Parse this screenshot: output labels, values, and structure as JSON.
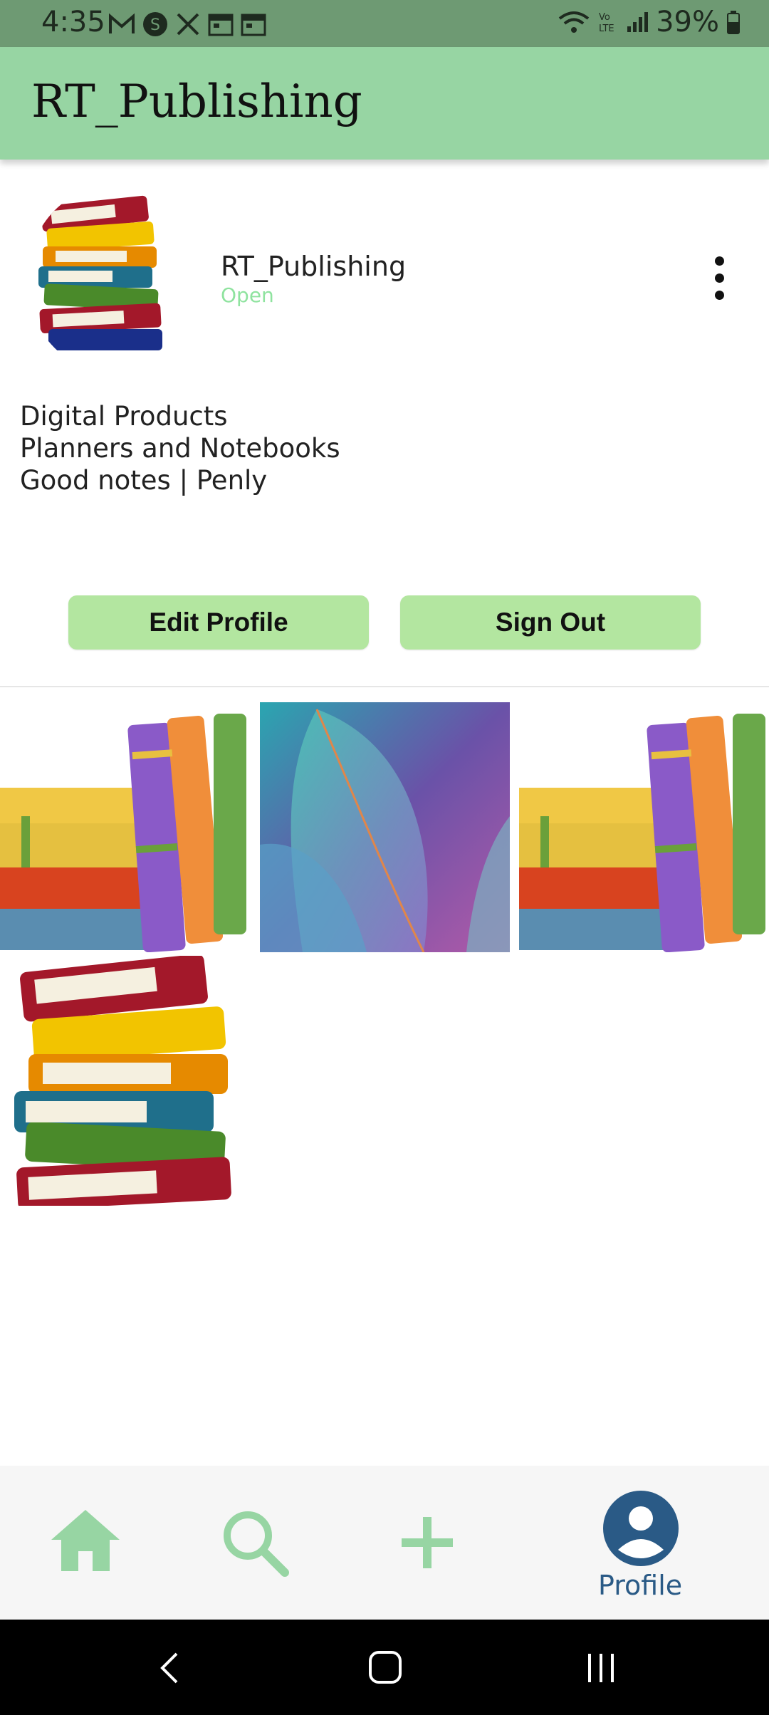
{
  "status_bar": {
    "time": "4:35",
    "notification_icons": [
      "gmail-icon",
      "shazam-icon",
      "x-icon",
      "calendar-icon",
      "calendar-icon"
    ],
    "battery": "39%"
  },
  "app_bar": {
    "title": "RT_Publishing"
  },
  "profile": {
    "username": "RT_Publishing",
    "status": "Open",
    "bio": [
      "Digital Products",
      "Planners and Notebooks",
      "Good notes | Penly"
    ]
  },
  "actions": {
    "edit_label": "Edit Profile",
    "signout_label": "Sign Out"
  },
  "grid": {
    "posts": [
      "books-shelf-image",
      "leaf-image",
      "books-shelf-image",
      "book-stack-image"
    ]
  },
  "bottom_nav": {
    "items": [
      {
        "icon": "home-icon"
      },
      {
        "icon": "search-icon"
      },
      {
        "icon": "add-icon"
      },
      {
        "icon": "profile-icon",
        "label": "Profile"
      }
    ],
    "accent": "#97d5a3",
    "active": "#2a5a86"
  },
  "colors": {
    "app_bar": "#97d5a3",
    "button": "#b3e6a0",
    "status_open": "#8fe39f"
  }
}
